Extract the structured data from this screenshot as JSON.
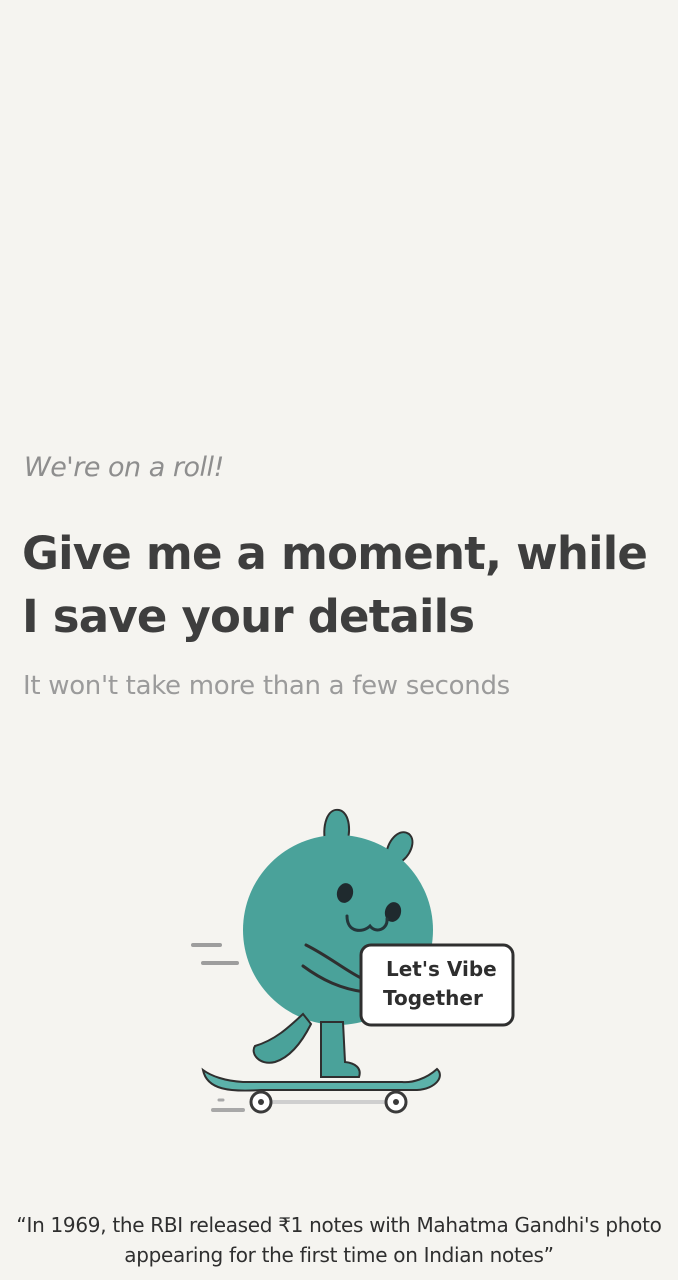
{
  "loading": {
    "intro": "We're on a roll!",
    "title": "Give me a moment, while I save your details",
    "subtitle": "It won't take more than a few seconds"
  },
  "illustration": {
    "icon": "mascot-skateboard-icon",
    "sign_line1": "Let's Vibe",
    "sign_line2": "Together"
  },
  "fact": {
    "text": "“In 1969, the RBI released ₹1 notes with Mahatma Gandhi's photo appearing for the first time on Indian notes”"
  },
  "colors": {
    "background": "#f5f4f0",
    "mascot": "#4aa29a",
    "heading": "#3e3e3e",
    "muted": "#9b9b9b"
  }
}
